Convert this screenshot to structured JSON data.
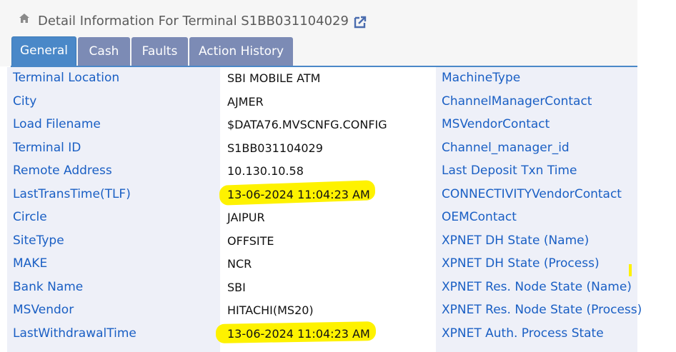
{
  "header": {
    "title": "Detail Information For Terminal S1BB031104029"
  },
  "tabs": [
    {
      "label": "General"
    },
    {
      "label": "Cash"
    },
    {
      "label": "Faults"
    },
    {
      "label": "Action History"
    }
  ],
  "rows": [
    {
      "label": "Terminal Location",
      "value": "SBI MOBILE ATM",
      "label2": "MachineType"
    },
    {
      "label": "City",
      "value": "AJMER",
      "label2": "ChannelManagerContact"
    },
    {
      "label": "Load Filename",
      "value": "$DATA76.MVSCNFG.CONFIG",
      "label2": "MSVendorContact"
    },
    {
      "label": "Terminal ID",
      "value": "S1BB031104029",
      "label2": "Channel_manager_id"
    },
    {
      "label": "Remote Address",
      "value": "10.130.10.58",
      "label2": "Last Deposit Txn Time"
    },
    {
      "label": "LastTransTime(TLF)",
      "value": "13-06-2024 11:04:23 AM",
      "label2": "CONNECTIVITYVendorContact"
    },
    {
      "label": "Circle",
      "value": "JAIPUR",
      "label2": "OEMContact"
    },
    {
      "label": "SiteType",
      "value": "OFFSITE",
      "label2": "XPNET DH State (Name)"
    },
    {
      "label": "MAKE",
      "value": "NCR",
      "label2": "XPNET DH State (Process)"
    },
    {
      "label": "Bank Name",
      "value": "SBI",
      "label2": "XPNET Res. Node State (Name)"
    },
    {
      "label": "MSVendor",
      "value": "HITACHI(MS20)",
      "label2": "XPNET Res. Node State (Process)"
    },
    {
      "label": "LastWithdrawalTime",
      "value": "13-06-2024 11:04:23 AM",
      "label2": "XPNET Auth. Process State"
    }
  ]
}
